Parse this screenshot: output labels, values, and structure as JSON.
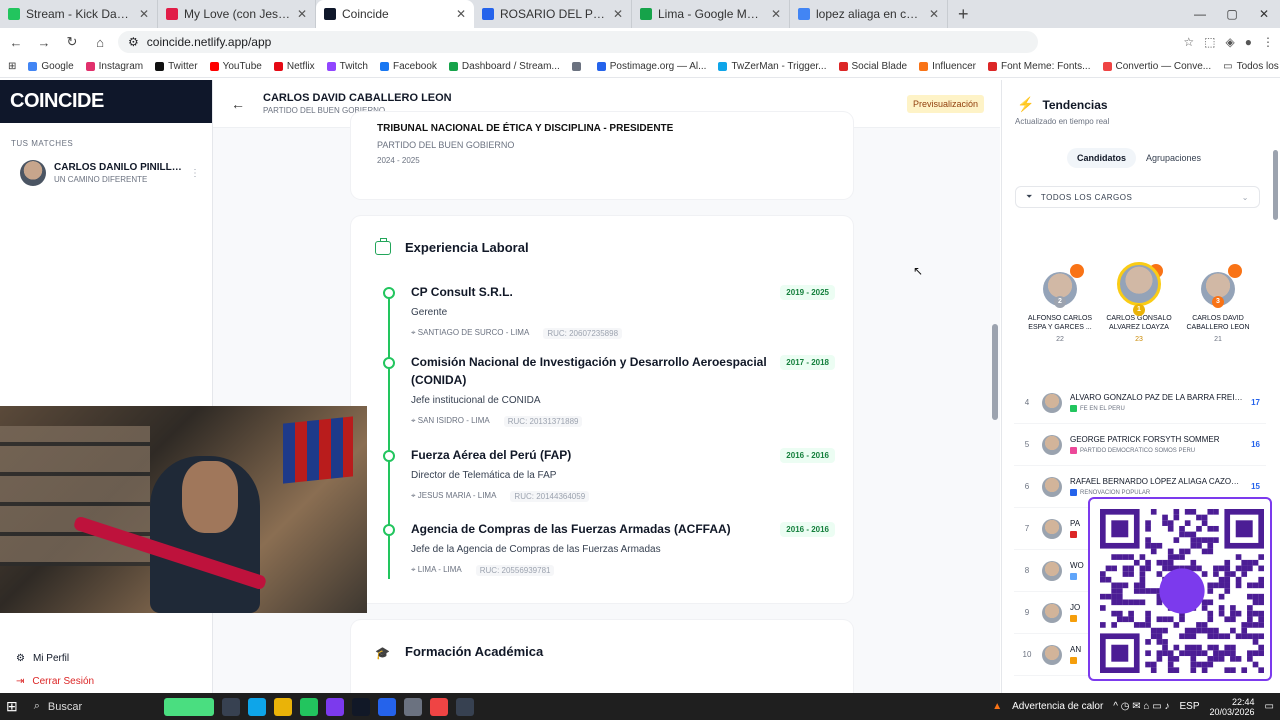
{
  "browser": {
    "tabs": [
      {
        "title": "Stream - Kick Dashboard",
        "color": "#22c55e",
        "active": false
      },
      {
        "title": "My Love (con Jess Glynne)",
        "color": "#e11d48",
        "active": false
      },
      {
        "title": "Coincide",
        "color": "#0f172a",
        "active": true
      },
      {
        "title": "ROSARIO DEL PILAR FERNANDEZ",
        "color": "#2563eb",
        "active": false
      },
      {
        "title": "Lima - Google Maps",
        "color": "#16a34a",
        "active": false
      },
      {
        "title": "lopez aliaga en chiclayo - Busca",
        "color": "#4285f4",
        "active": false
      }
    ],
    "url": "coincide.netlify.app/app",
    "bookmarks": [
      "Google",
      "Instagram",
      "Twitter",
      "YouTube",
      "Netflix",
      "Twitch",
      "Facebook",
      "Dashboard / Stream...",
      "",
      "Postimage.org — Al...",
      "TwZerMan - Trigger...",
      "Social Blade",
      "Influencer",
      "Font Meme: Fonts...",
      "Convertio — Conve..."
    ],
    "bookmarks_all": "Todos los marcadores"
  },
  "sidebar": {
    "brand": "COINCIDE",
    "matches_label": "TUS MATCHES",
    "match": {
      "name": "CARLOS DANILO PINILLO...",
      "party": "UN CAMINO DIFERENTE"
    },
    "profile": "Mi Perfil",
    "logout": "Cerrar Sesión"
  },
  "header": {
    "name": "CARLOS DAVID CABALLERO LEON",
    "party": "PARTIDO DEL BUEN GOBIERNO",
    "badge": "Previsualización"
  },
  "prev_card": {
    "role": "TRIBUNAL NACIONAL DE ÉTICA Y DISCIPLINA - PRESIDENTE",
    "party": "PARTIDO DEL BUEN GOBIERNO",
    "years": "2024 - 2025"
  },
  "experience": {
    "title": "Experiencia Laboral",
    "jobs": [
      {
        "company": "CP Consult S.R.L.",
        "position": "Gerente",
        "location": "SANTIAGO DE SURCO - LIMA",
        "ruc": "RUC: 20607235898",
        "years": "2019 - 2025"
      },
      {
        "company": "Comisión Nacional de Investigación y Desarrollo Aeroespacial (CONIDA)",
        "position": "Jefe institucional de CONIDA",
        "location": "SAN ISIDRO - LIMA",
        "ruc": "RUC: 20131371889",
        "years": "2017 - 2018"
      },
      {
        "company": "Fuerza Aérea del Perú (FAP)",
        "position": "Director de Telemática de la FAP",
        "location": "JESUS MARIA - LIMA",
        "ruc": "RUC: 20144364059",
        "years": "2016 - 2016"
      },
      {
        "company": "Agencia de Compras de las Fuerzas Armadas (ACFFAA)",
        "position": "Jefe de la Agencia de Compras de las Fuerzas Armadas",
        "location": "LIMA - LIMA",
        "ruc": "RUC: 20556939781",
        "years": "2016 - 2016"
      }
    ]
  },
  "education": {
    "title": "Formación Académica"
  },
  "trends": {
    "title": "Tendencias",
    "subtitle": "Actualizado en tiempo real",
    "tab_candidates": "Candidatos",
    "tab_groups": "Agrupaciones",
    "filter": "TODOS LOS CARGOS",
    "podium": [
      {
        "name": "ALFONSO CARLOS ESPA Y GARCES ...",
        "value": "22",
        "rank": "2",
        "rank_color": "#9ca3af"
      },
      {
        "name": "CARLOS GONSALO ALVAREZ LOAYZA",
        "value": "23",
        "rank": "1",
        "rank_color": "#eab308"
      },
      {
        "name": "CARLOS DAVID CABALLERO LEON",
        "value": "21",
        "rank": "3",
        "rank_color": "#f97316"
      }
    ],
    "list": [
      {
        "rank": "4",
        "name": "ALVARO GONZALO PAZ DE LA BARRA FREIG...",
        "party": "FE EN EL PERU",
        "party_color": "#22c55e",
        "value": "17"
      },
      {
        "rank": "5",
        "name": "GEORGE PATRICK FORSYTH SOMMER",
        "party": "PARTIDO DEMOCRÁTICO SOMOS PERÚ",
        "party_color": "#ec4899",
        "value": "16"
      },
      {
        "rank": "6",
        "name": "RAFAEL BERNARDO LÓPEZ ALIAGA CAZORLA",
        "party": "RENOVACIÓN POPULAR",
        "party_color": "#2563eb",
        "value": "15"
      },
      {
        "rank": "7",
        "name": "PA",
        "party": "",
        "party_color": "#dc2626",
        "value": ""
      },
      {
        "rank": "8",
        "name": "WO",
        "party": "",
        "party_color": "#60a5fa",
        "value": ""
      },
      {
        "rank": "9",
        "name": "JO",
        "party": "",
        "party_color": "#f59e0b",
        "value": ""
      },
      {
        "rank": "10",
        "name": "AN",
        "party": "",
        "party_color": "#f59e0b",
        "value": ""
      }
    ]
  },
  "taskbar": {
    "search": "Buscar",
    "weather": "Advertencia de calor",
    "lang": "ESP",
    "time": "22:44",
    "date": "20/03/2026"
  }
}
